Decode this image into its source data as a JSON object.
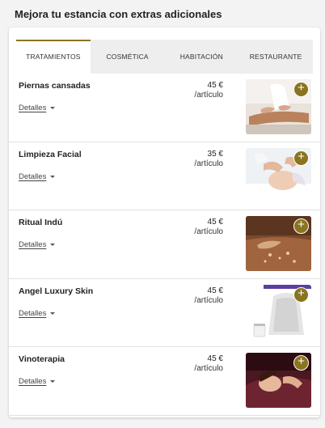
{
  "header": {
    "title": "Mejora tu estancia con extras adicionales"
  },
  "tabs": [
    {
      "label": "TRATAMIENTOS"
    },
    {
      "label": "COSMÉTICA"
    },
    {
      "label": "HABITACIÓN"
    },
    {
      "label": "RESTAURANTE"
    }
  ],
  "items": [
    {
      "name": "Piernas cansadas",
      "price": "45 €",
      "unit": "/artículo",
      "details": "Detalles",
      "add": "+",
      "photo_icon": "massage-photo-icon"
    },
    {
      "name": "Limpieza Facial",
      "price": "35 €",
      "unit": "/artículo",
      "details": "Detalles",
      "add": "+",
      "photo_icon": "facial-photo-icon"
    },
    {
      "name": "Ritual Indú",
      "price": "45 €",
      "unit": "/artículo",
      "details": "Detalles",
      "add": "+",
      "photo_icon": "scrub-photo-icon"
    },
    {
      "name": "Angel Luxury Skin",
      "price": "45 €",
      "unit": "/artículo",
      "details": "Detalles",
      "add": "+",
      "photo_icon": "cosmetics-photo-icon"
    },
    {
      "name": "Vinoterapia",
      "price": "45 €",
      "unit": "/artículo",
      "details": "Detalles",
      "add": "+",
      "photo_icon": "wine-therapy-photo-icon"
    }
  ],
  "colors": {
    "accent": "#8a7420",
    "background": "#f3f3f3"
  }
}
